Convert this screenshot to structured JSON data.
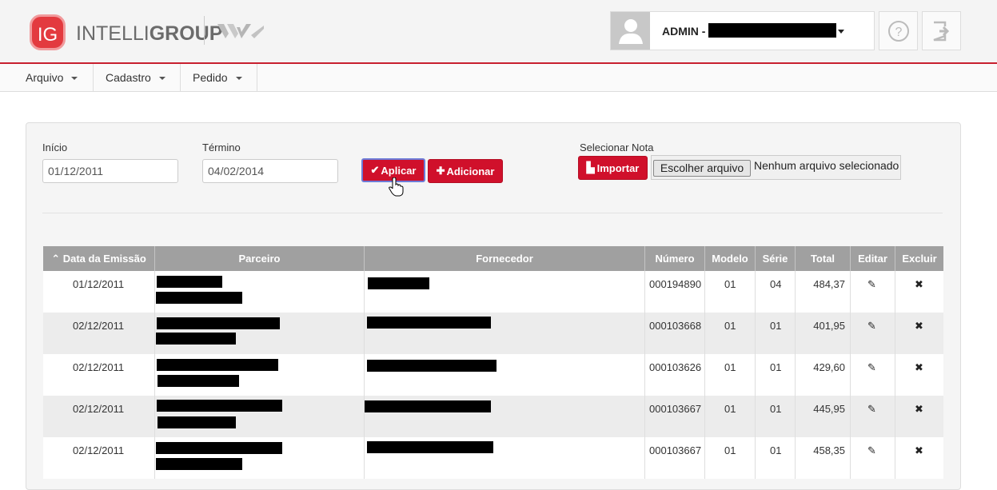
{
  "header": {
    "logo_mark": "IG",
    "logo_text_light": "INTELLI",
    "logo_text_bold": "GROUP",
    "user_name": "ADMIN -",
    "help_icon": "question-circle-icon",
    "logout_icon": "sign-out-icon"
  },
  "menu": [
    {
      "label": "Arquivo"
    },
    {
      "label": "Cadastro"
    },
    {
      "label": "Pedido"
    }
  ],
  "filters": {
    "start_label": "Início",
    "start_value": "01/12/2011",
    "end_label": "Término",
    "end_value": "04/02/2014",
    "apply_label": "Aplicar",
    "add_label": "Adicionar",
    "select_note_label": "Selecionar Nota",
    "import_label": "Importar",
    "choose_file_label": "Escolher arquivo",
    "no_file_label": "Nenhum arquivo selecionado"
  },
  "table": {
    "headers": [
      "Data da Emissão",
      "Parceiro",
      "Fornecedor",
      "Número",
      "Modelo",
      "Série",
      "Total",
      "Editar",
      "Excluir"
    ],
    "rows": [
      {
        "date": "01/12/2011",
        "numero": "000194890",
        "modelo": "01",
        "serie": "04",
        "total": "484,37"
      },
      {
        "date": "02/12/2011",
        "numero": "000103668",
        "modelo": "01",
        "serie": "01",
        "total": "401,95"
      },
      {
        "date": "02/12/2011",
        "numero": "000103626",
        "modelo": "01",
        "serie": "01",
        "total": "429,60"
      },
      {
        "date": "02/12/2011",
        "numero": "000103667",
        "modelo": "01",
        "serie": "01",
        "total": "445,95"
      },
      {
        "date": "02/12/2011",
        "numero": "000103667",
        "modelo": "01",
        "serie": "01",
        "total": "458,35"
      }
    ]
  },
  "colors": {
    "accent": "#d0102b",
    "header_bg": "#f4f4f4",
    "table_header": "#a0a0a0"
  }
}
